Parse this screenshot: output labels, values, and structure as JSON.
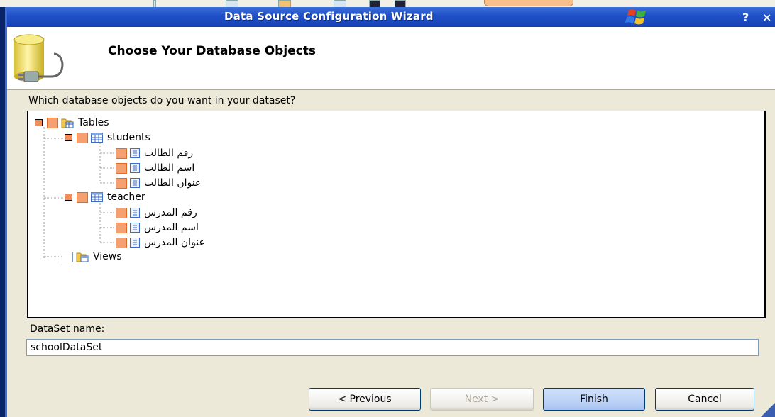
{
  "window": {
    "title": "Data Source Configuration Wizard",
    "help_label": "?",
    "close_label": "×"
  },
  "header": {
    "title": "Choose Your Database Objects"
  },
  "main": {
    "question": "Which database objects do you want in your dataset?",
    "tree": {
      "tables_label": "Tables",
      "views_label": "Views",
      "students": {
        "label": "students",
        "columns": [
          "رقم الطالب",
          "اسم الطالب",
          "عنوان الطالب"
        ]
      },
      "teacher": {
        "label": "teacher",
        "columns": [
          "رقم المدرس",
          "اسم المدرس",
          "عنوان المدرس"
        ]
      }
    },
    "dataset_label": "DataSet name:",
    "dataset_value": "schoolDataSet"
  },
  "buttons": {
    "previous": "< Previous",
    "next": "Next >",
    "finish": "Finish",
    "cancel": "Cancel"
  },
  "colors": {
    "titlebar": "#1f4fc7",
    "checkbox_fill": "#f4a070"
  },
  "icons": [
    "database-plug-icon",
    "folder-table-icon",
    "table-icon",
    "column-icon",
    "windows-logo-icon"
  ]
}
